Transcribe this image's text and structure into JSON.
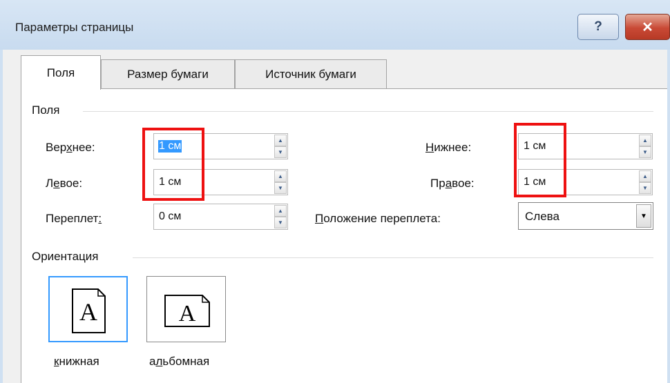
{
  "window": {
    "title": "Параметры страницы",
    "help_symbol": "?",
    "close_symbol": "✕"
  },
  "tabs": [
    {
      "label": "Поля",
      "active": true
    },
    {
      "label": "Размер бумаги",
      "active": false
    },
    {
      "label": "Источник бумаги",
      "active": false
    }
  ],
  "margins_section": {
    "legend": "Поля",
    "top": {
      "label_pre": "Вер",
      "label_accel": "х",
      "label_post": "нее:",
      "value": "1 см"
    },
    "bottom": {
      "label_pre": "",
      "label_accel": "Н",
      "label_post": "ижнее:",
      "value": "1 см"
    },
    "left": {
      "label_pre": "Л",
      "label_accel": "е",
      "label_post": "вое:",
      "value": "1 см"
    },
    "right": {
      "label_pre": "Пр",
      "label_accel": "а",
      "label_post": "вое:",
      "value": "1 см"
    },
    "gutter": {
      "label_pre": "Переплет",
      "label_accel": ":",
      "label_post": "",
      "value": "0 см"
    },
    "gutter_position": {
      "label_pre": "",
      "label_accel": "П",
      "label_post": "оложение переплета:",
      "value": "Слева"
    }
  },
  "orientation_section": {
    "legend": "Ориентация",
    "page_glyph": "A",
    "portrait": {
      "label_pre": "",
      "label_accel": "к",
      "label_post": "нижная",
      "selected": true
    },
    "landscape": {
      "label_pre": "а",
      "label_accel": "л",
      "label_post": "ьбомная",
      "selected": false
    }
  },
  "annotation_color": "#ee1111",
  "selection_color": "#3399ff"
}
